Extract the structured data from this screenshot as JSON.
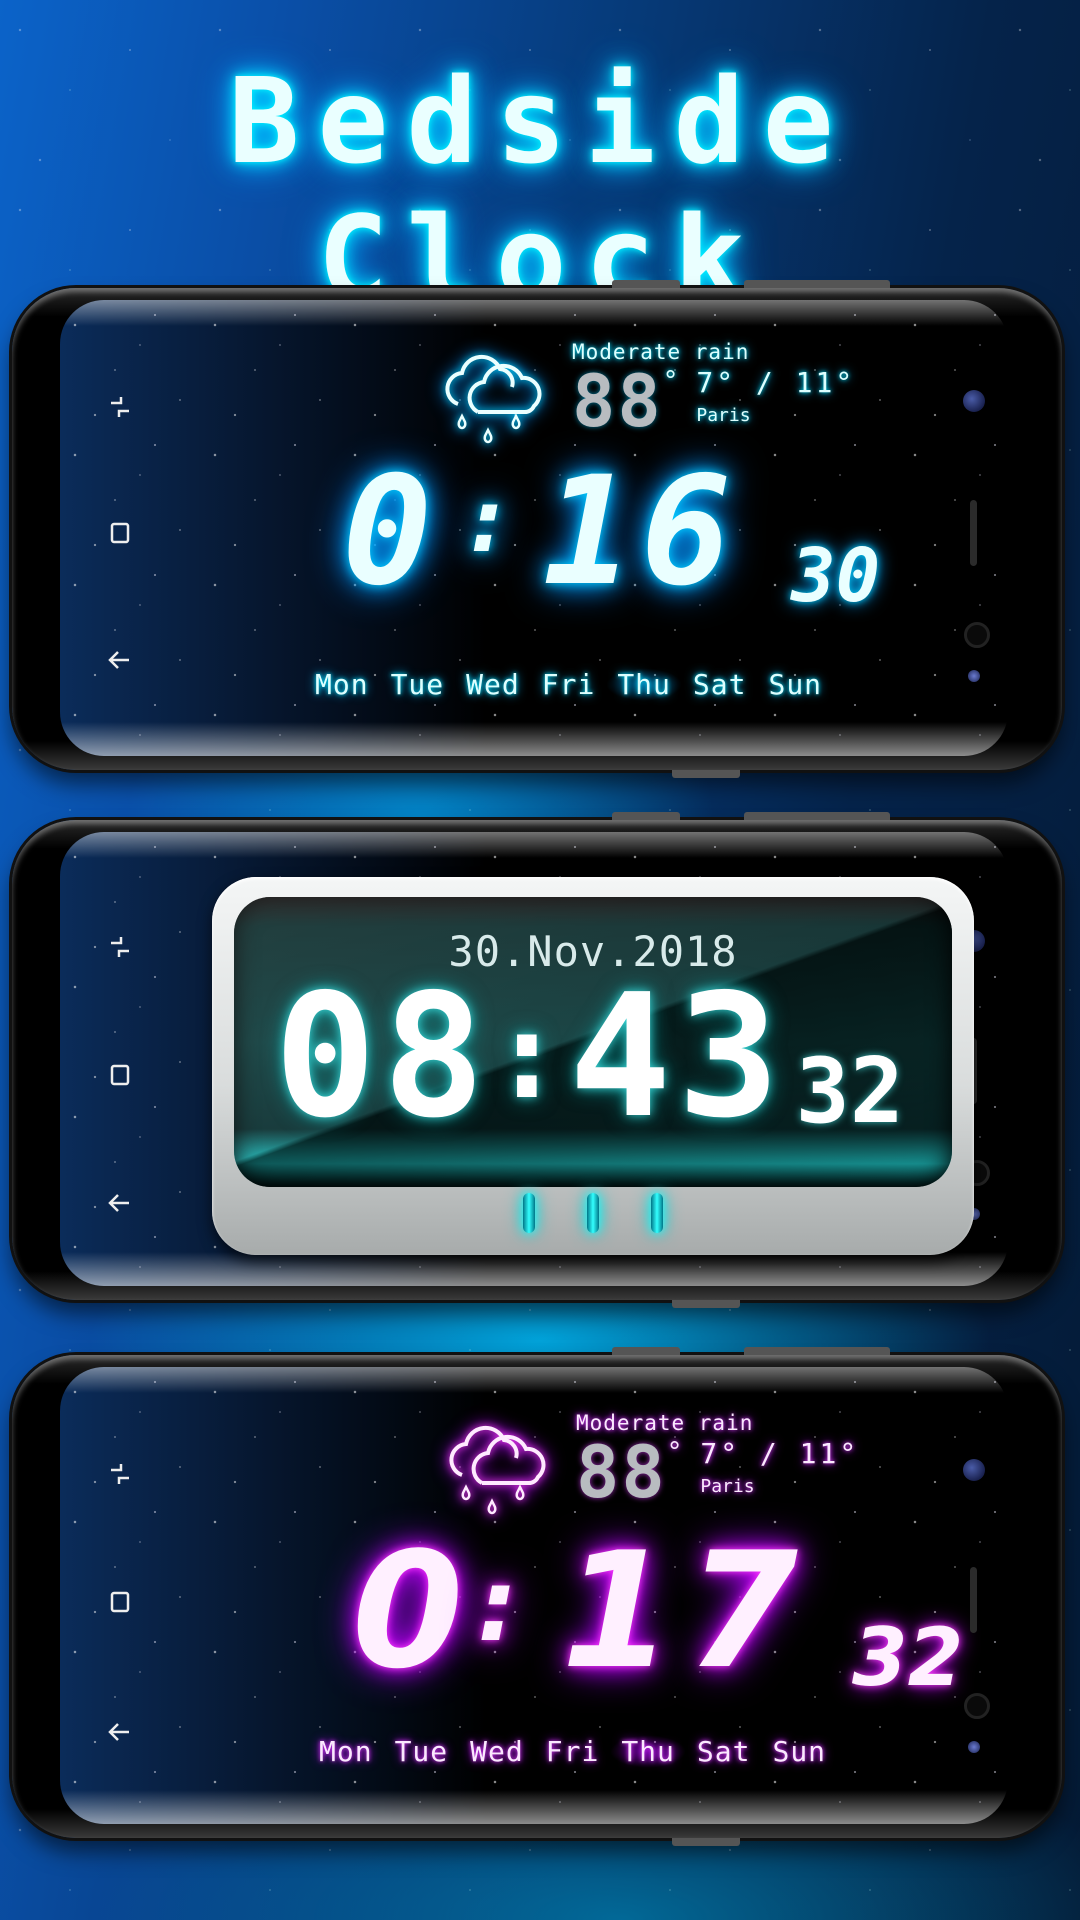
{
  "title": "Bedside Clock",
  "colors": {
    "title_glow": "#00e5ff",
    "blue_theme": "#00b8ff",
    "teal_theme": "#1fc7c7",
    "purple_theme": "#c000ff"
  },
  "nav_icons": [
    "recent-apps-icon",
    "home-icon",
    "back-icon"
  ],
  "screens": [
    {
      "theme": "blue-dot-matrix",
      "weather": {
        "icon": "cloud-rain-icon",
        "description": "Moderate rain",
        "current_temp": "88",
        "degree": "°",
        "range": "7° / 11°",
        "city": "Paris"
      },
      "clock": {
        "hours": "0",
        "separator": ":",
        "minutes": "16",
        "seconds": "30"
      },
      "days": [
        "Mon",
        "Tue",
        "Wed",
        "Fri",
        "Thu",
        "Sat",
        "Sun"
      ],
      "active_day": "Thu"
    },
    {
      "theme": "teal-retro-led",
      "date": "30.Nov.2018",
      "clock": {
        "hours": "08",
        "separator": ":",
        "minutes": "43",
        "seconds": "32"
      },
      "indicator_lights": 3
    },
    {
      "theme": "purple-seven-segment",
      "weather": {
        "icon": "cloud-rain-icon",
        "description": "Moderate rain",
        "current_temp": "88",
        "degree": "°",
        "range": "7° / 11°",
        "city": "Paris"
      },
      "clock": {
        "hours": "0",
        "separator": ":",
        "minutes": "17",
        "seconds": "32"
      },
      "days": [
        "Mon",
        "Tue",
        "Wed",
        "Fri",
        "Thu",
        "Sat",
        "Sun"
      ],
      "active_day": "Thu"
    }
  ]
}
